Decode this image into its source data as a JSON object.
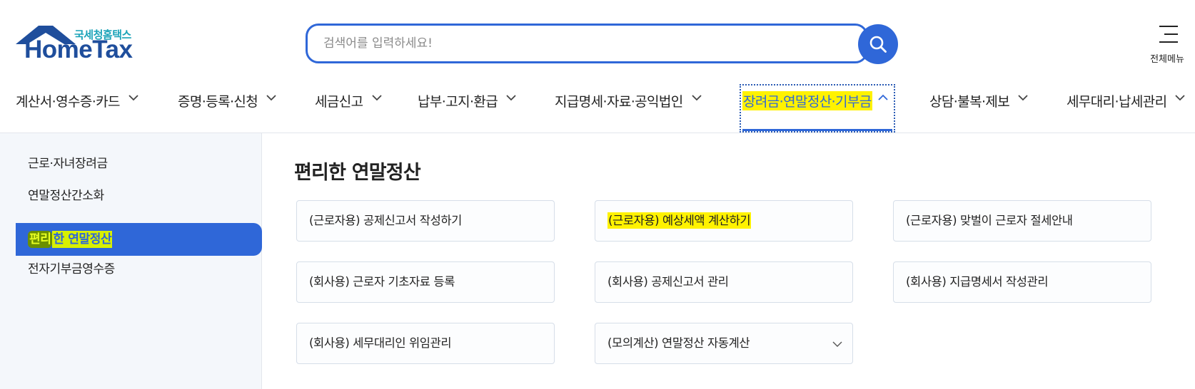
{
  "header": {
    "logo_sub": "국세청홈택스",
    "logo_brand": "HomeTax",
    "search_placeholder": "검색어를 입력하세요!",
    "all_menu_label": "전체메뉴"
  },
  "gnb": {
    "items": [
      {
        "label": "계산서·영수증·카드"
      },
      {
        "label": "증명·등록·신청"
      },
      {
        "label": "세금신고"
      },
      {
        "label": "납부·고지·환급"
      },
      {
        "label": "지급명세·자료·공익법인"
      },
      {
        "label": "장려금·연말정산·기부금",
        "active": true
      },
      {
        "label": "상담·불복·제보"
      },
      {
        "label": "세무대리·납세관리"
      }
    ]
  },
  "lnb": {
    "items": [
      {
        "label": "근로·자녀장려금"
      },
      {
        "label": "연말정산간소화"
      },
      {
        "label_hl": "편리",
        "label_rest": "한 연말정산",
        "active": true
      },
      {
        "label": "전자기부금영수증"
      }
    ]
  },
  "content": {
    "title": "편리한 연말정산",
    "cards": [
      {
        "label": "(근로자용) 공제신고서 작성하기"
      },
      {
        "label": "(근로자용) 예상세액 계산하기",
        "highlighted": true
      },
      {
        "label": "(근로자용) 맞벌이 근로자 절세안내"
      },
      {
        "label": "(회사용) 근로자 기초자료 등록"
      },
      {
        "label": "(회사용) 공제신고서 관리"
      },
      {
        "label": "(회사용) 지급명세서 작성관리"
      },
      {
        "label": "(회사용) 세무대리인 위임관리"
      },
      {
        "label": "(모의계산) 연말정산 자동계산",
        "has_dropdown": true
      }
    ]
  },
  "colors": {
    "primary": "#2f67d8",
    "logo_blue": "#1f4e9c",
    "logo_teal": "#1aa3b8",
    "highlight_yellow": "#fff200",
    "lnb_bg": "#f4f7fb"
  }
}
